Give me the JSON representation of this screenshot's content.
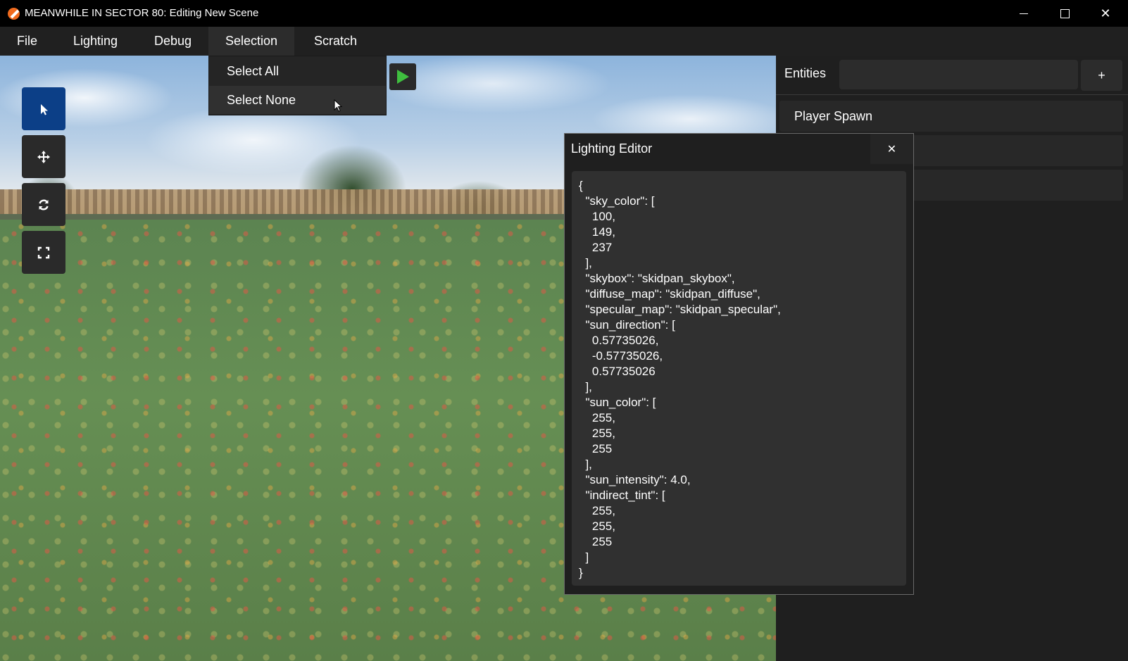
{
  "window": {
    "title": "MEANWHILE IN SECTOR 80: Editing New Scene",
    "controls": {
      "minimize_icon": "minimize-icon",
      "maximize_icon": "maximize-icon",
      "close_label": "✕"
    }
  },
  "menubar": {
    "items": [
      {
        "label": "File"
      },
      {
        "label": "Lighting"
      },
      {
        "label": "Debug"
      },
      {
        "label": "Selection"
      },
      {
        "label": "Scratch"
      }
    ]
  },
  "selection_menu": {
    "items": [
      {
        "label": "Select All"
      },
      {
        "label": "Select None"
      }
    ]
  },
  "tools": [
    {
      "icon": "pointer-icon",
      "active": true
    },
    {
      "icon": "move-icon",
      "active": false
    },
    {
      "icon": "rotate-icon",
      "active": false
    },
    {
      "icon": "scale-icon",
      "active": false
    }
  ],
  "entities_panel": {
    "label": "Entities",
    "search_value": "",
    "add_label": "+",
    "items": [
      {
        "label": "Player Spawn"
      },
      {
        "label": ""
      },
      {
        "label": ""
      }
    ]
  },
  "lighting_editor": {
    "title": "Lighting Editor",
    "close_label": "✕",
    "content": "{\n  \"sky_color\": [\n    100,\n    149,\n    237\n  ],\n  \"skybox\": \"skidpan_skybox\",\n  \"diffuse_map\": \"skidpan_diffuse\",\n  \"specular_map\": \"skidpan_specular\",\n  \"sun_direction\": [\n    0.57735026,\n    -0.57735026,\n    0.57735026\n  ],\n  \"sun_color\": [\n    255,\n    255,\n    255\n  ],\n  \"sun_intensity\": 4.0,\n  \"indirect_tint\": [\n    255,\n    255,\n    255\n  ]\n}"
  },
  "colors": {
    "accent": "#0c3f87",
    "play": "#3fbf3f",
    "app_icon": "#f06a1d"
  }
}
